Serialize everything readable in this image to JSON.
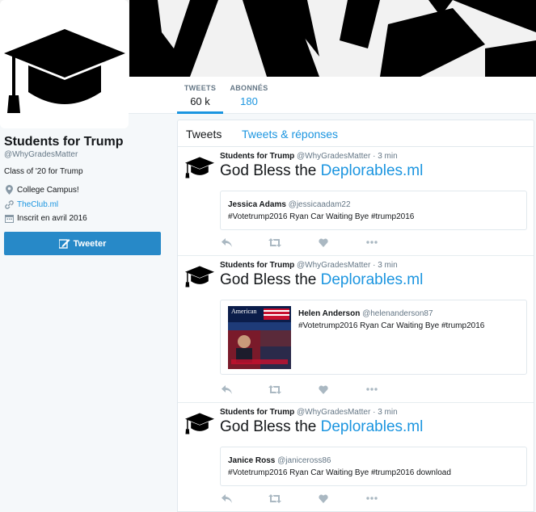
{
  "profile": {
    "name": "Students for Trump",
    "handle": "@WhyGradesMatter",
    "bio": "Class of '20 for Trump",
    "location": "College Campus!",
    "website": "TheClub.ml",
    "joined": "Inscrit en avril 2016",
    "tweet_button": "Tweeter"
  },
  "stats": [
    {
      "label": "TWEETS",
      "value": "60 k"
    },
    {
      "label": "ABONNÉS",
      "value": "180"
    }
  ],
  "tabs": [
    {
      "label": "Tweets"
    },
    {
      "label": "Tweets & réponses"
    }
  ],
  "tweets": [
    {
      "author": "Students for Trump",
      "handle": "@WhyGradesMatter",
      "time": "· 3 min",
      "text": "God Bless the ",
      "link": "Deplorables.ml",
      "quote": {
        "name": "Jessica Adams",
        "handle": "@jessicaadam22",
        "text": "#Votetrump2016 Ryan Car Waiting Bye #trump2016"
      }
    },
    {
      "author": "Students for Trump",
      "handle": "@WhyGradesMatter",
      "time": "· 3 min",
      "text": "God Bless the ",
      "link": "Deplorables.ml",
      "quote": {
        "name": "Helen Anderson",
        "handle": "@helenanderson87",
        "text": "#Votetrump2016 Ryan Car Waiting Bye #trump2016",
        "image_caption": "American"
      }
    },
    {
      "author": "Students for Trump",
      "handle": "@WhyGradesMatter",
      "time": "· 3 min",
      "text": "God Bless the ",
      "link": "Deplorables.ml",
      "quote": {
        "name": "Janice Ross",
        "handle": "@janiceross86",
        "text": "#Votetrump2016 Ryan Car Waiting Bye #trump2016 download"
      }
    }
  ],
  "colors": {
    "accent": "#1b95e0",
    "button": "#2789c8",
    "muted": "#657786",
    "text": "#14171a"
  },
  "icons": [
    "graduation-cap-icon",
    "location-pin-icon",
    "link-icon",
    "calendar-icon",
    "compose-icon",
    "reply-icon",
    "retweet-icon",
    "like-icon",
    "more-icon"
  ]
}
